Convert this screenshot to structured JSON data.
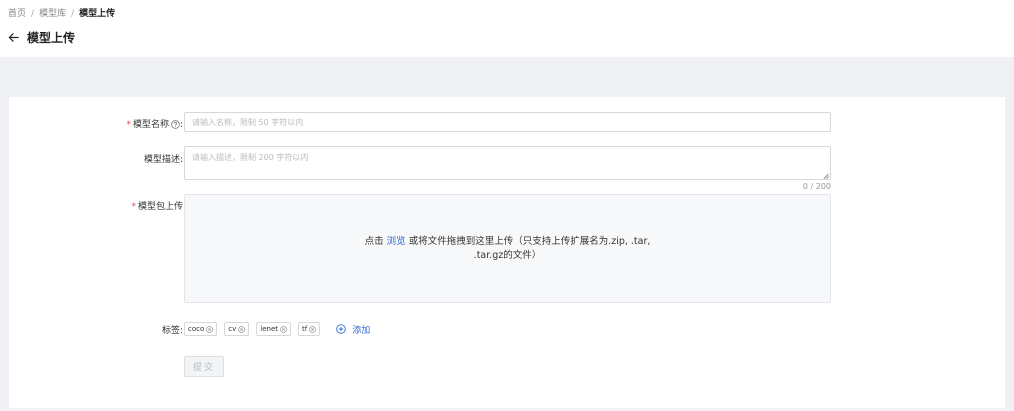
{
  "breadcrumb": {
    "items": [
      "首页",
      "模型库",
      "模型上传"
    ],
    "separator": "/"
  },
  "header": {
    "title": "模型上传",
    "back_icon": "arrow-left-icon"
  },
  "form": {
    "name": {
      "label": "模型名称",
      "required_mark": "*",
      "label_suffix": ":",
      "placeholder": "请输入名称，限制 50 字符以内",
      "value": ""
    },
    "description": {
      "label": "模型描述",
      "label_suffix": ":",
      "placeholder": "请输入描述，限制 200 字符以内",
      "value": "",
      "counter": "0 / 200"
    },
    "package": {
      "label": "模型包上传",
      "required_mark": "*",
      "prompt_prefix": "点击",
      "browse_link": "浏览",
      "prompt_suffix": "或将文件拖拽到这里上传（只支持上传扩展名为.zip, .tar, .tar.gz的文件）"
    },
    "tags": {
      "label": "标签",
      "label_suffix": ":",
      "items": [
        "coco",
        "cv",
        "lenet",
        "tf"
      ],
      "add_label": "添加"
    },
    "submit_label": "提交"
  },
  "colors": {
    "accent": "#2f6bdc",
    "required": "#e5484d",
    "page_background": "#f0f1f5"
  }
}
